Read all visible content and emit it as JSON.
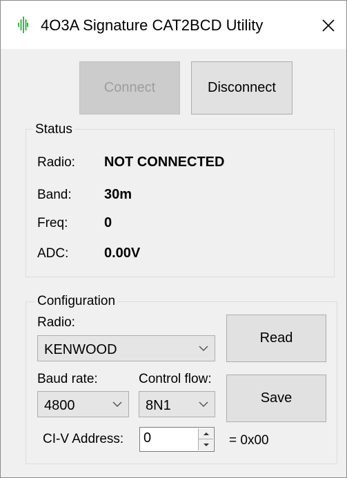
{
  "window": {
    "title": "4O3A Signature CAT2BCD Utility"
  },
  "toolbar": {
    "connect_label": "Connect",
    "disconnect_label": "Disconnect"
  },
  "status": {
    "legend": "Status",
    "rows": [
      {
        "label": "Radio:",
        "value": "NOT CONNECTED"
      },
      {
        "label": "Band:",
        "value": "30m"
      },
      {
        "label": "Freq:",
        "value": "0"
      },
      {
        "label": "ADC:",
        "value": "0.00V"
      }
    ]
  },
  "configuration": {
    "legend": "Configuration",
    "radio_label": "Radio:",
    "radio_value": "KENWOOD",
    "baud_label": "Baud rate:",
    "baud_value": "4800",
    "flow_label": "Control flow:",
    "flow_value": "8N1",
    "civ_label": "CI-V Address:",
    "civ_value": "0",
    "civ_hex": "= 0x00",
    "read_label": "Read",
    "save_label": "Save"
  },
  "colors": {
    "icon_green": "#3bb54a",
    "window_bg": "#f0f0f0",
    "button_bg": "#e1e1e1",
    "disabled_text": "#9d9d9d"
  },
  "icons": {
    "app": "waveform-icon",
    "close": "close-icon",
    "dropdown": "chevron-down-icon",
    "spin_up": "caret-up-icon",
    "spin_down": "caret-down-icon"
  }
}
